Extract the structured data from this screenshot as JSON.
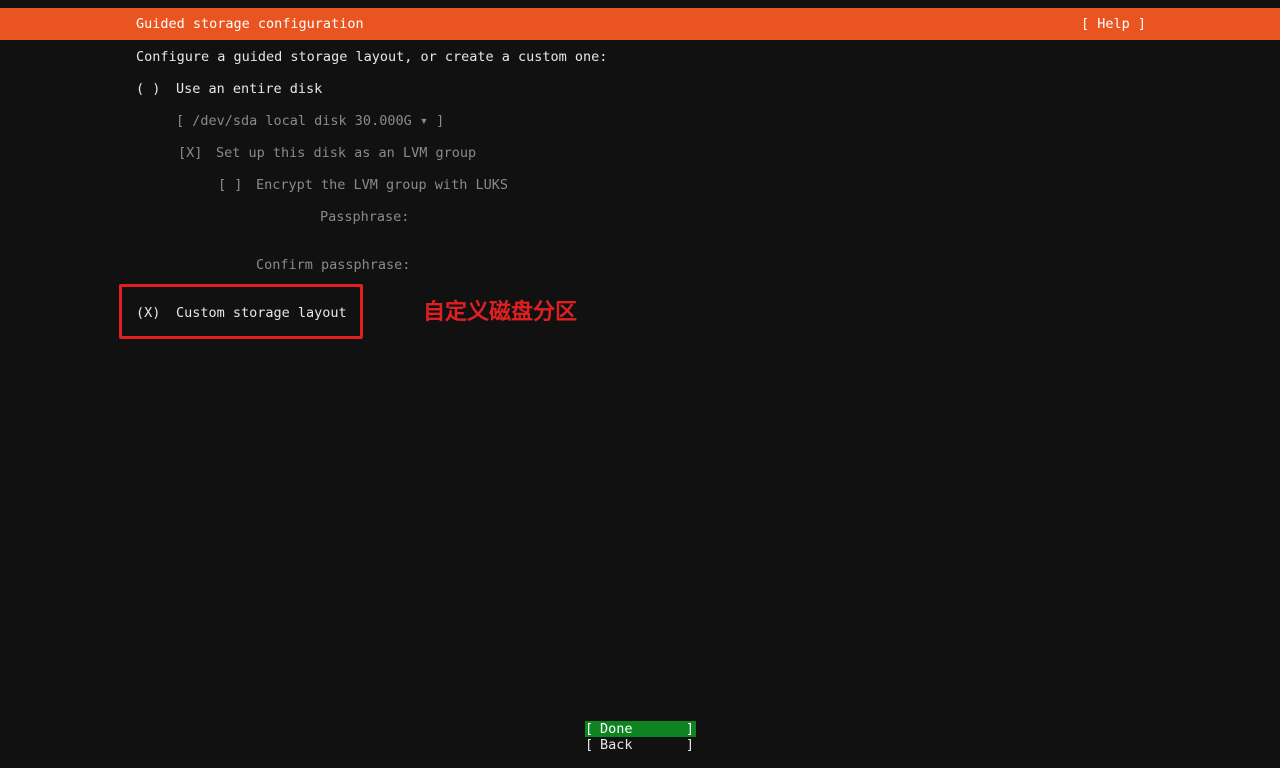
{
  "header": {
    "title": "Guided storage configuration",
    "help": "[ Help ]"
  },
  "intro": "Configure a guided storage layout, or create a custom one:",
  "entire_disk": {
    "radio": "( )",
    "label": "Use an entire disk",
    "disk_select": "[ /dev/sda local disk 30.000G ▾ ]",
    "lvm_checkbox": "[X]",
    "lvm_label": "Set up this disk as an LVM group",
    "encrypt_checkbox": "[ ]",
    "encrypt_label": "Encrypt the LVM group with LUKS",
    "passphrase_label": "Passphrase:",
    "confirm_label": "Confirm passphrase:"
  },
  "custom": {
    "radio": "(X)",
    "label": "Custom storage layout"
  },
  "annotation": "自定义磁盘分区",
  "buttons": {
    "done": {
      "left": "[",
      "label": "Done",
      "right": "]"
    },
    "back": {
      "left": "[",
      "label": "Back",
      "right": "]"
    }
  },
  "colors": {
    "header_bg": "#e95420",
    "background": "#111111",
    "done_bg": "#0e8420",
    "annotation": "#e02020"
  }
}
